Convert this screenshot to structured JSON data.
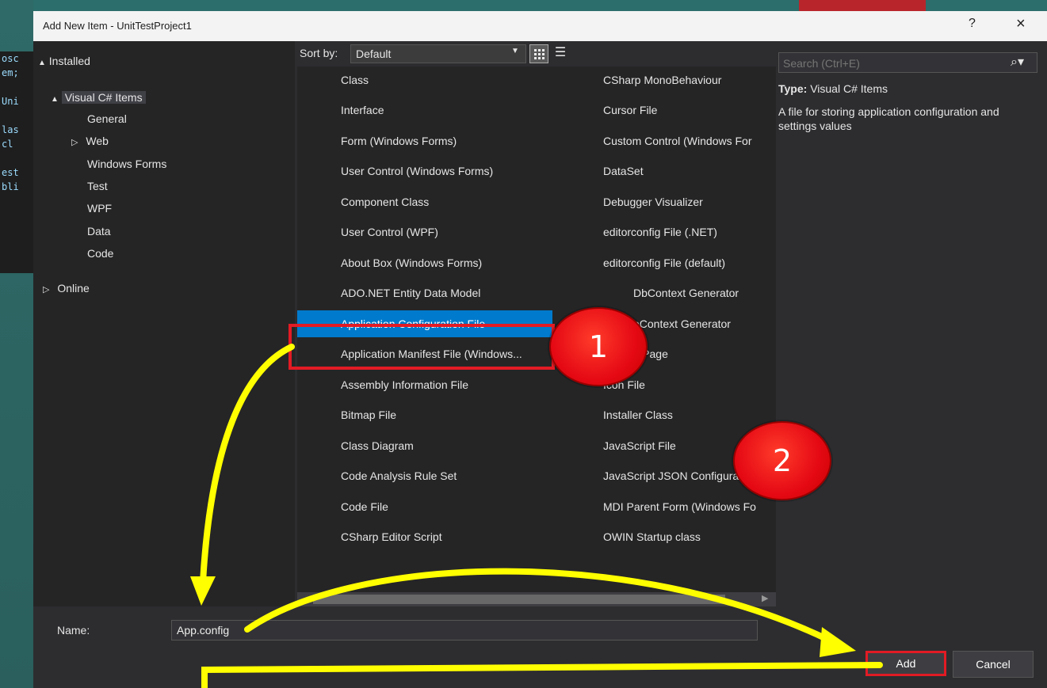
{
  "window": {
    "title": "Add New Item - UnitTestProject1",
    "help_label": "?",
    "close_label": "×"
  },
  "background_code": [
    "osc",
    "em;",
    "",
    "Uni",
    "",
    "las",
    "cl",
    "",
    "est",
    "bli"
  ],
  "tree": {
    "installed": "Installed",
    "visual_csharp": "Visual C# Items",
    "children": [
      "General",
      "Web",
      "Windows Forms",
      "Test",
      "WPF",
      "Data",
      "Code"
    ],
    "online": "Online",
    "expand_glyph": "▲",
    "collapsed_glyph": "▷"
  },
  "sort": {
    "label": "Sort by:",
    "value": "Default"
  },
  "items_col1": [
    "Class",
    "Interface",
    "Form (Windows Forms)",
    "User Control (Windows Forms)",
    "Component Class",
    "User Control (WPF)",
    "About Box (Windows Forms)",
    "ADO.NET Entity Data Model",
    "Application Configuration File",
    "Application Manifest File (Windows...",
    "Assembly Information File",
    "Bitmap File",
    "Class Diagram",
    "Code Analysis Rule Set",
    "Code File",
    "CSharp Editor Script"
  ],
  "items_col2": [
    "CSharp MonoBehaviour",
    "Cursor File",
    "Custom Control (Windows For",
    "DataSet",
    "Debugger Visualizer",
    "editorconfig File (.NET)",
    "editorconfig File (default)",
    "DbContext Generator",
    "oContext Generator",
    "L Page",
    "Icon File",
    "Installer Class",
    "JavaScript File",
    "JavaScript JSON Configura",
    "MDI Parent Form (Windows Fo",
    "OWIN Startup class"
  ],
  "search": {
    "placeholder": "Search (Ctrl+E)"
  },
  "info": {
    "type_label": "Type:",
    "type_value": "Visual C# Items",
    "description": "A file for storing application configuration and settings values"
  },
  "name_field": {
    "label": "Name:",
    "value": "App.config"
  },
  "buttons": {
    "add": "Add",
    "cancel": "Cancel"
  },
  "annotations": {
    "badge1": "1",
    "badge2": "2",
    "highlight_color": "#e21b24",
    "arrow_color": "#ffff00"
  }
}
